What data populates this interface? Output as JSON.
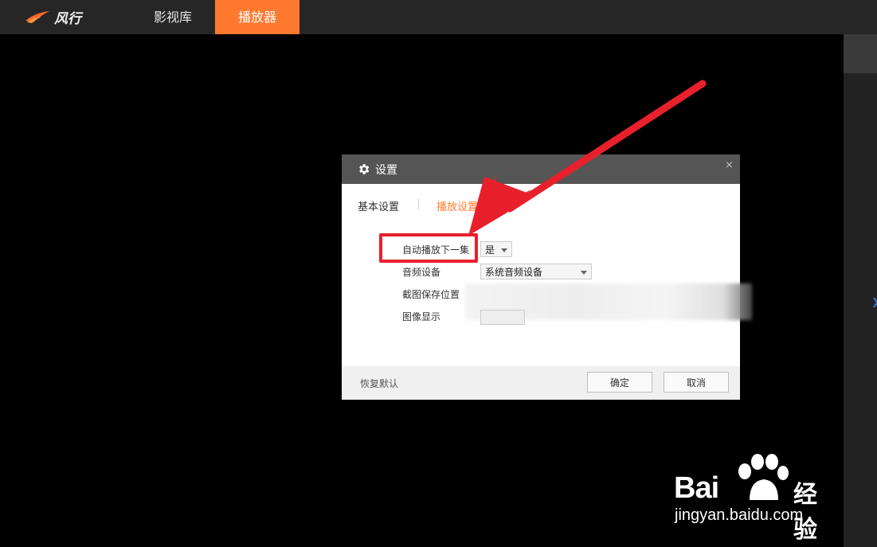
{
  "topbar": {
    "logo_text": "风行",
    "tabs": [
      {
        "label": "影视库"
      },
      {
        "label": "播放器"
      }
    ]
  },
  "dialog": {
    "title": "设置",
    "close": "×",
    "tabs": [
      {
        "label": "基本设置"
      },
      {
        "label": "播放设置"
      }
    ],
    "rows": [
      {
        "label": "自动播放下一集",
        "value": "是"
      },
      {
        "label": "音频设备",
        "value": "系统音频设备"
      },
      {
        "label": "截图保存位置"
      },
      {
        "label": "图像显示"
      }
    ],
    "footer": {
      "restore": "恢复默认",
      "ok": "确定",
      "cancel": "取消"
    }
  },
  "watermark": {
    "brand": "Bai",
    "brand_suffix": "经验",
    "url": "jingyan.baidu.com"
  },
  "colors": {
    "accent": "#ff7a2f",
    "annotation": "#e8202c",
    "topbar": "#262626"
  },
  "icons": [
    "fengxing-logo-icon",
    "gear-icon",
    "close-icon",
    "chevron-down-icon",
    "baidu-paw-icon"
  ]
}
